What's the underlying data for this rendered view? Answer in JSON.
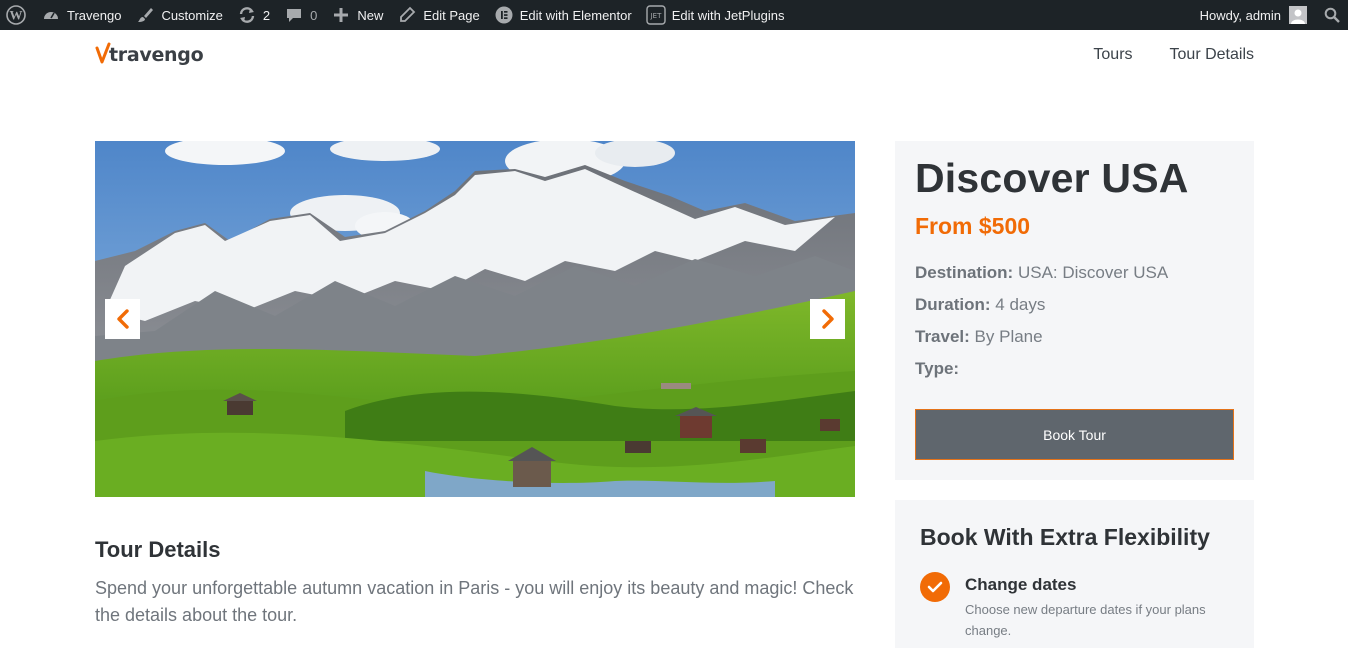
{
  "admin_bar": {
    "site_name": "Travengo",
    "customize": "Customize",
    "updates_count": "2",
    "comments_count": "0",
    "new": "New",
    "edit_page": "Edit Page",
    "edit_elementor": "Edit with Elementor",
    "edit_jetplugins": "Edit with JetPlugins",
    "howdy": "Howdy, admin"
  },
  "header": {
    "logo_text": "travengo",
    "nav": [
      "Tours",
      "Tour Details"
    ]
  },
  "tour": {
    "title": "Discover USA",
    "price": "From $500",
    "destination_label": "Destination:",
    "destination_value": "USA: Discover USA",
    "duration_label": "Duration:",
    "duration_value": "4 days",
    "travel_label": "Travel:",
    "travel_value": "By Plane",
    "type_label": "Type:",
    "book_button": "Book Tour"
  },
  "details": {
    "heading": "Tour Details",
    "text": "Spend your unforgettable autumn vacation in Paris - you will enjoy its beauty and magic! Check the details about the tour."
  },
  "flexibility": {
    "heading": "Book With Extra Flexibility",
    "items": [
      {
        "title": "Change dates",
        "desc": "Choose new departure dates if your plans change."
      }
    ]
  },
  "colors": {
    "accent": "#f16b06",
    "admin_bar": "#1d2327",
    "card_bg": "#f5f6f8",
    "button_bg": "#5f666d"
  },
  "icons": [
    "wordpress-icon",
    "dashboard-icon",
    "brush-icon",
    "updates-icon",
    "comment-icon",
    "plus-icon",
    "pencil-icon",
    "elementor-icon",
    "jetplugins-icon",
    "search-icon",
    "chevron-left-icon",
    "chevron-right-icon",
    "check-icon"
  ]
}
